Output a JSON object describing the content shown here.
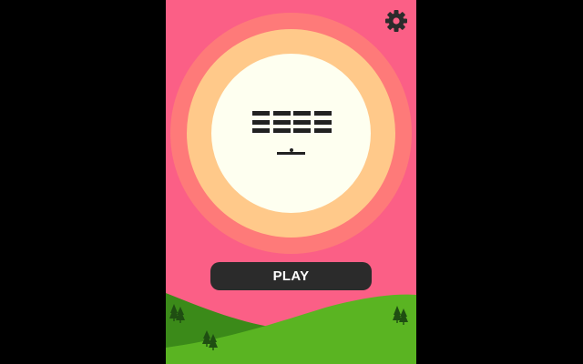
{
  "game": {
    "play_label": "PLAY",
    "settings_icon": "gear-icon",
    "brick_rows": 3,
    "brick_cols": 4
  },
  "colors": {
    "background": "#fb5f86",
    "ring_outer": "#fe7a79",
    "ring_middle": "#ffc98a",
    "ring_inner": "#fefff0",
    "hill_dark": "#3b8a19",
    "hill_light": "#5ab422",
    "ui_dark": "#2b2b2b"
  }
}
